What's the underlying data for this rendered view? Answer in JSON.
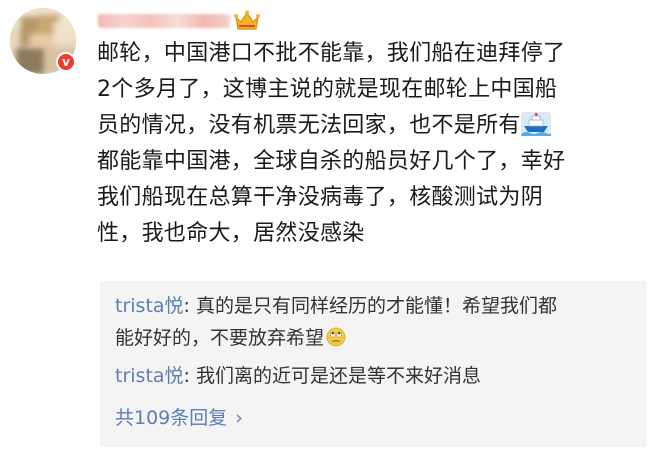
{
  "comment": {
    "line1": "邮轮，中国港口不批不能靠，我们船在迪拜停了",
    "line2": "2个多月了，这博主说的就是现在邮轮上中国船",
    "line3": "员的情况，没有机票无法回家，也不是所有",
    "line4": "都能靠中国港，全球自杀的船员好几个了，幸好",
    "line5": "我们船现在总算干净没病毒了，核酸测试为阴",
    "line6": "性，我也命大，居然没感染",
    "inline_icon": "ship-emoji",
    "user_badge_icon": "crown-icon"
  },
  "replies": [
    {
      "user": "trista悦",
      "sep": ": ",
      "text_a": "真的是只有同样经历的才能懂！希望我们都",
      "text_b": "能好好的，不要放弃希望",
      "trailing_icon": "rolling-eyes-emoji"
    },
    {
      "user": "trista悦",
      "sep": ": ",
      "text_a": "我们离的近可是还是等不来好消息"
    }
  ],
  "more_replies": {
    "label": "共109条回复",
    "chevron": "›"
  },
  "colors": {
    "link": "#5b7fb4",
    "text": "#1a1a1a",
    "reply_bg": "#f4f4f4",
    "badge": "#f23b2a"
  }
}
